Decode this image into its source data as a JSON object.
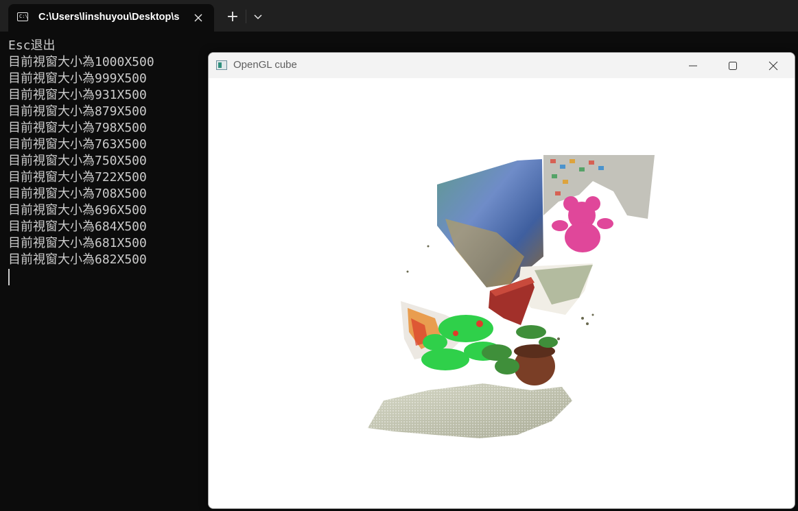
{
  "terminal": {
    "tab_title": "C:\\Users\\linshuyou\\Desktop\\s",
    "tab_icon": "terminal-icon",
    "new_tab_label": "+",
    "lines": [
      "Esc退出",
      "目前視窗大小為1000X500",
      "目前視窗大小為999X500",
      "目前視窗大小為931X500",
      "目前視窗大小為879X500",
      "目前視窗大小為798X500",
      "目前視窗大小為763X500",
      "目前視窗大小為750X500",
      "目前視窗大小為722X500",
      "目前視窗大小為708X500",
      "目前視窗大小為696X500",
      "目前視窗大小為684X500",
      "目前視窗大小為681X500",
      "目前視窗大小為682X500"
    ]
  },
  "gl_window": {
    "title": "OpenGL cube",
    "icons": [
      "app-icon",
      "minimize-icon",
      "maximize-icon",
      "close-icon"
    ],
    "content": "point-cloud-scene"
  },
  "colors": {
    "terminal_bg": "#0c0c0c",
    "tabstrip_bg": "#202020",
    "console_text": "#cccccc",
    "window_titlebar": "#f3f3f3"
  }
}
